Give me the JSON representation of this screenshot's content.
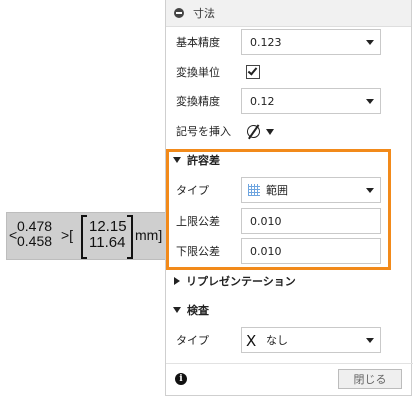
{
  "preview": {
    "lt": "<",
    "upper_tol": "0.478",
    "lower_tol": "0.458",
    "gt": ">[",
    "upper_limit": "12.15",
    "lower_limit": "11.64",
    "unit": "mm]"
  },
  "panel": {
    "header_title": "寸法",
    "fields": {
      "base_precision": {
        "label": "基本精度",
        "value": "0.123"
      },
      "convert_units": {
        "label": "変換単位",
        "checked": true
      },
      "convert_precision": {
        "label": "変換精度",
        "value": "0.12"
      },
      "insert_symbol": {
        "label": "記号を挿入",
        "symbol": "Ø"
      }
    },
    "tolerance": {
      "heading": "許容差",
      "type_label": "タイプ",
      "type_value": "範囲",
      "upper_label": "上限公差",
      "upper_value": "0.010",
      "lower_label": "下限公差",
      "lower_value": "0.010"
    },
    "representation": {
      "heading": "リプレゼンテーション"
    },
    "inspection": {
      "heading": "検査",
      "type_label": "タイプ",
      "type_value": "なし",
      "type_icon": "X"
    },
    "footer": {
      "close_label": "閉じる",
      "info_icon": "i"
    }
  },
  "colors": {
    "highlight": "#f28a1a",
    "range_icon": "#4a8fd9"
  }
}
